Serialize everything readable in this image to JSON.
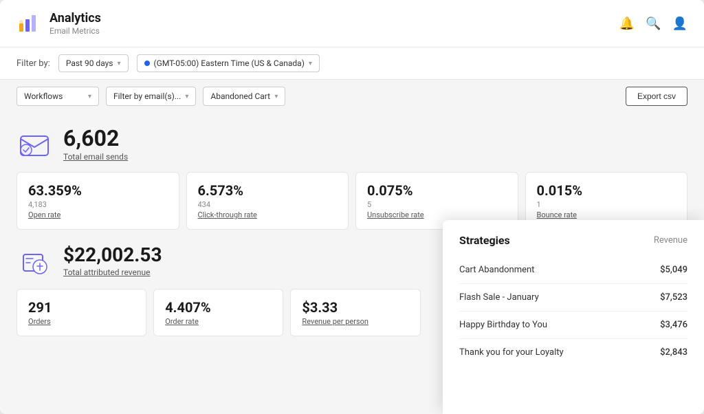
{
  "header": {
    "app_name": "Analytics",
    "subtitle": "Email Metrics",
    "icons": [
      "bell",
      "search",
      "user"
    ]
  },
  "filter_bar": {
    "label": "Filter by:",
    "time_period": "Past 90 days",
    "timezone": "(GMT-05:00) Eastern Time (US & Canada)"
  },
  "filter_row2": {
    "dropdown1": "Workflows",
    "dropdown2": "Filter by email(s)...",
    "dropdown3": "Abandoned Cart",
    "export_label": "Export csv"
  },
  "email_sends": {
    "count": "6,602",
    "label": "Total email sends"
  },
  "stats": [
    {
      "value": "63.359%",
      "sub": "4,183",
      "label": "Open rate"
    },
    {
      "value": "6.573%",
      "sub": "434",
      "label": "Click-through rate"
    },
    {
      "value": "0.075%",
      "sub": "5",
      "label": "Unsubscribe rate"
    },
    {
      "value": "0.015%",
      "sub": "1",
      "label": "Bounce rate"
    }
  ],
  "revenue": {
    "amount": "$22,002.53",
    "label": "Total attributed revenue"
  },
  "rev_stats": [
    {
      "value": "291",
      "label": "Orders"
    },
    {
      "value": "4.407%",
      "label": "Order rate"
    },
    {
      "value": "$3.33",
      "label": "Revenue per person"
    }
  ],
  "strategies": {
    "title": "Strategies",
    "revenue_header": "Revenue",
    "items": [
      {
        "name": "Cart Abandonment",
        "revenue": "$5,049"
      },
      {
        "name": "Flash Sale - January",
        "revenue": "$7,523"
      },
      {
        "name": "Happy Birthday to You",
        "revenue": "$3,476"
      },
      {
        "name": "Thank you for your Loyalty",
        "revenue": "$2,843"
      }
    ]
  }
}
